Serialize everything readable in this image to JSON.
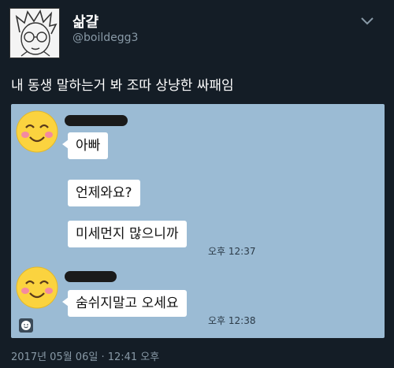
{
  "header": {
    "display_name": "삶걀",
    "handle": "@boildegg3"
  },
  "tweet": {
    "text": "내 동생 말하는거 봐 조따 상냥한 싸패임"
  },
  "chat": {
    "group1": {
      "messages": [
        "아빠",
        "언제와요?",
        "미세먼지 많으니까"
      ],
      "time": "오후 12:37"
    },
    "group2": {
      "messages": [
        "숨쉬지말고 오세요"
      ],
      "time": "오후 12:38"
    },
    "colors": {
      "background": "#9bbbd4",
      "bubble": "#ffffff",
      "smiley_face": "#fbd33f",
      "smiley_cheek": "#f48aa0"
    }
  },
  "footer": {
    "timestamp": "2017년 05월 06일 · 12:41 오후"
  }
}
